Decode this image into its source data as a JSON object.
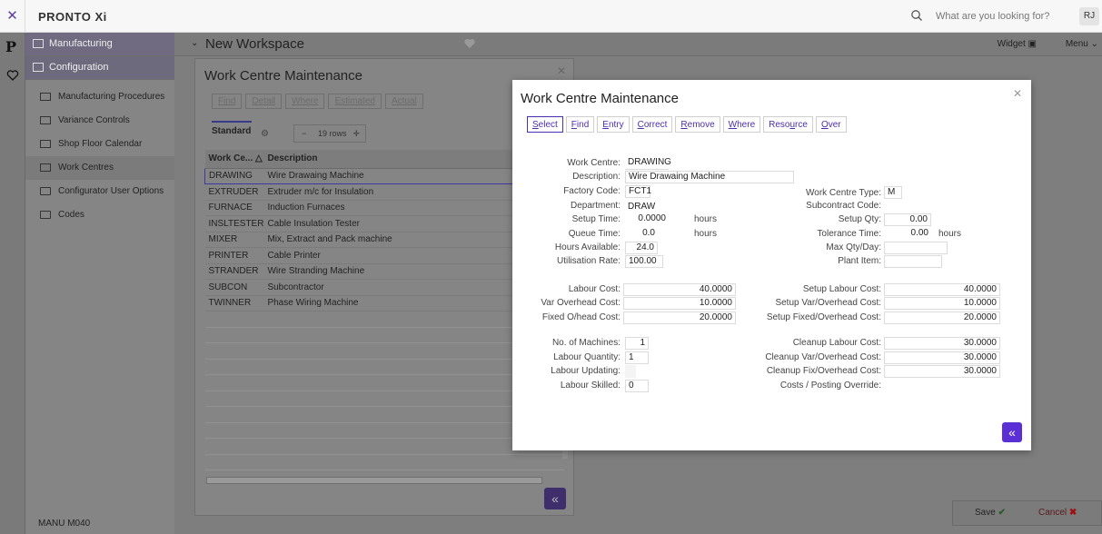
{
  "topbar": {
    "brand": "PRONTO Xi",
    "search_placeholder": "What are you looking for?",
    "avatar": "RJ"
  },
  "sidebar": {
    "sections": [
      {
        "label": "Manufacturing",
        "icon": "manufacturing-icon"
      },
      {
        "label": "Configuration",
        "icon": "configuration-icon"
      }
    ],
    "items": [
      {
        "label": "Manufacturing Procedures",
        "icon": "window-icon"
      },
      {
        "label": "Variance Controls",
        "icon": "window-icon"
      },
      {
        "label": "Shop Floor Calendar",
        "icon": "window-icon"
      },
      {
        "label": "Work Centres",
        "icon": "window-icon",
        "selected": true
      },
      {
        "label": "Configurator User Options",
        "icon": "folder-icon"
      },
      {
        "label": "Codes",
        "icon": "folder-icon"
      }
    ],
    "footer": "MANU M040"
  },
  "workspace": {
    "title": "New Workspace",
    "widget": "Widget",
    "menu": "Menu"
  },
  "back_dialog": {
    "title": "Work Centre Maintenance",
    "buttons": [
      "Find",
      "Detail",
      "Where",
      "Estimated",
      "Actual"
    ],
    "tab": "Standard",
    "rows_label": "19 rows",
    "columns": [
      "Work Ce...",
      "Description"
    ],
    "rows": [
      {
        "code": "DRAWING",
        "desc": "Wire Drawaing Machine"
      },
      {
        "code": "EXTRUDER",
        "desc": "Extruder m/c for Insulation"
      },
      {
        "code": "FURNACE",
        "desc": "Induction Furnaces"
      },
      {
        "code": "INSLTESTER",
        "desc": "Cable Insulation Tester"
      },
      {
        "code": "MIXER",
        "desc": "Mix, Extract and Pack machine"
      },
      {
        "code": "PRINTER",
        "desc": "Cable Printer"
      },
      {
        "code": "STRANDER",
        "desc": "Wire Stranding Machine"
      },
      {
        "code": "SUBCON",
        "desc": "Subcontractor"
      },
      {
        "code": "TWINNER",
        "desc": "Phase Wiring Machine"
      }
    ]
  },
  "front_dialog": {
    "title": "Work Centre Maintenance",
    "buttons": [
      {
        "pre": "",
        "u": "S",
        "post": "elect"
      },
      {
        "pre": "",
        "u": "F",
        "post": "ind"
      },
      {
        "pre": "",
        "u": "E",
        "post": "ntry"
      },
      {
        "pre": "",
        "u": "C",
        "post": "orrect"
      },
      {
        "pre": "",
        "u": "R",
        "post": "emove"
      },
      {
        "pre": "",
        "u": "W",
        "post": "here"
      },
      {
        "pre": "Reso",
        "u": "u",
        "post": "rce"
      },
      {
        "pre": "",
        "u": "O",
        "post": "ver"
      }
    ],
    "left": {
      "work_centre_label": "Work Centre:",
      "work_centre": "DRAWING",
      "description_label": "Description:",
      "description": "Wire Drawaing Machine",
      "factory_code_label": "Factory Code:",
      "factory_code": "FCT1",
      "department_label": "Department:",
      "department": "DRAW",
      "setup_time_label": "Setup Time:",
      "setup_time": "0.0000",
      "setup_time_unit": "hours",
      "queue_time_label": "Queue Time:",
      "queue_time": "0.0",
      "queue_time_unit": "hours",
      "hours_available_label": "Hours Available:",
      "hours_available": "24.0",
      "utilisation_rate_label": "Utilisation Rate:",
      "utilisation_rate": "100.00",
      "labour_cost_label": "Labour Cost:",
      "labour_cost": "40.0000",
      "var_overhead_cost_label": "Var Overhead Cost:",
      "var_overhead_cost": "10.0000",
      "fixed_overhead_cost_label": "Fixed O/head Cost:",
      "fixed_overhead_cost": "20.0000",
      "no_machines_label": "No. of Machines:",
      "no_machines": "1",
      "labour_quantity_label": "Labour Quantity:",
      "labour_quantity": "1",
      "labour_updating_label": "Labour Updating:",
      "labour_updating": "",
      "labour_skilled_label": "Labour Skilled:",
      "labour_skilled": "0"
    },
    "right": {
      "work_centre_type_label": "Work Centre Type:",
      "work_centre_type": "M",
      "subcontract_code_label": "Subcontract Code:",
      "subcontract_code": "",
      "setup_qty_label": "Setup Qty:",
      "setup_qty": "0.00",
      "tolerance_time_label": "Tolerance Time:",
      "tolerance_time": "0.00",
      "tolerance_time_unit": "hours",
      "max_qty_day_label": "Max Qty/Day:",
      "max_qty_day": "",
      "plant_item_label": "Plant Item:",
      "plant_item": "",
      "setup_labour_cost_label": "Setup Labour Cost:",
      "setup_labour_cost": "40.0000",
      "setup_var_overhead_label": "Setup Var/Overhead Cost:",
      "setup_var_overhead": "10.0000",
      "setup_fixed_overhead_label": "Setup Fixed/Overhead Cost:",
      "setup_fixed_overhead": "20.0000",
      "cleanup_labour_cost_label": "Cleanup Labour Cost:",
      "cleanup_labour_cost": "30.0000",
      "cleanup_var_overhead_label": "Cleanup Var/Overhead Cost:",
      "cleanup_var_overhead": "30.0000",
      "cleanup_fix_overhead_label": "Cleanup Fix/Overhead Cost:",
      "cleanup_fix_overhead": "30.0000",
      "costs_posting_override_label": "Costs / Posting Override:"
    }
  },
  "actions": {
    "save": "Save",
    "cancel": "Cancel"
  },
  "colors": {
    "accent": "#4b2fb0",
    "fab": "#5b2fd6"
  }
}
